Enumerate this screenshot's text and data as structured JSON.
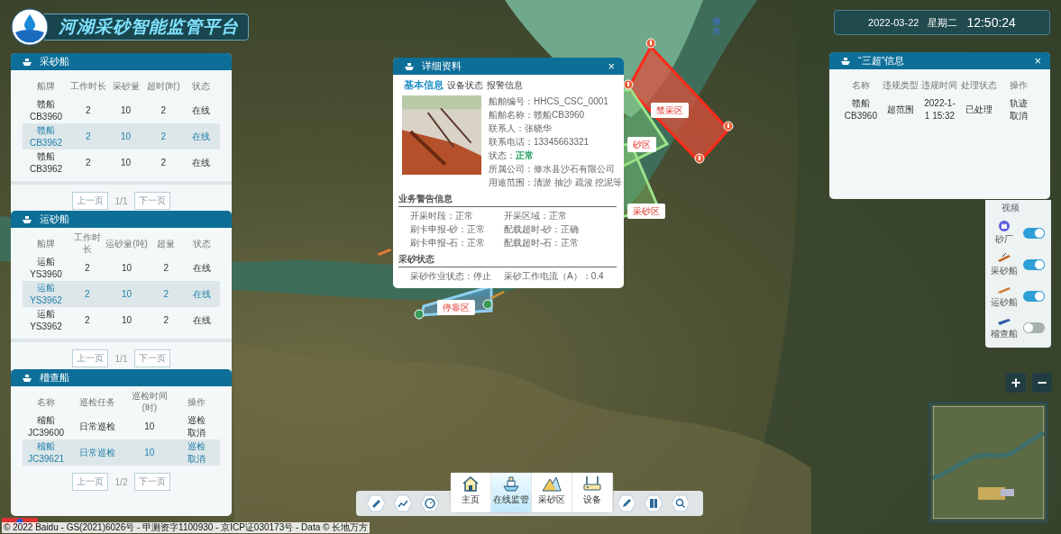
{
  "header": {
    "title": "河湖采砂智能监管平台"
  },
  "clock": {
    "date": "2022-03-22",
    "weekday": "星期二",
    "time": "12:50:24"
  },
  "mining_ships": {
    "title": "采砂船",
    "columns": [
      "船牌",
      "工作时长",
      "采砂量",
      "超时(时)",
      "状态"
    ],
    "rows": [
      {
        "cells": [
          "赣船 CB3960",
          "2",
          "10",
          "2",
          "在线"
        ],
        "selected": false
      },
      {
        "cells": [
          "赣船 CB3962",
          "2",
          "10",
          "2",
          "在线"
        ],
        "selected": true
      },
      {
        "cells": [
          "赣船 CB3962",
          "2",
          "10",
          "2",
          "在线"
        ],
        "selected": false
      }
    ],
    "pager": {
      "prev": "上一页",
      "page": "1/1",
      "next": "下一页"
    }
  },
  "transport_ships": {
    "title": "运砂船",
    "columns": [
      "船牌",
      "工作时长",
      "运砂量(吨)",
      "超量",
      "状态"
    ],
    "rows": [
      {
        "cells": [
          "运船 YS3960",
          "2",
          "10",
          "2",
          "在线"
        ],
        "selected": false
      },
      {
        "cells": [
          "运船 YS3962",
          "2",
          "10",
          "2",
          "在线"
        ],
        "selected": true
      },
      {
        "cells": [
          "运船 YS3962",
          "2",
          "10",
          "2",
          "在线"
        ],
        "selected": false
      }
    ],
    "pager": {
      "prev": "上一页",
      "page": "1/1",
      "next": "下一页"
    }
  },
  "patrol_ships": {
    "title": "稽查船",
    "columns": [
      "名称",
      "巡检任务",
      "巡检时间(时)",
      "操作"
    ],
    "rows": [
      {
        "cells": [
          "稽船 JC39600",
          "日常巡检",
          "10"
        ],
        "actions": [
          "巡检",
          "取消"
        ],
        "selected": false
      },
      {
        "cells": [
          "稽船 JC39621",
          "日常巡检",
          "10"
        ],
        "actions": [
          "巡检",
          "取消"
        ],
        "selected": true
      }
    ],
    "pager": {
      "prev": "上一页",
      "page": "1/2",
      "next": "下一页"
    }
  },
  "detail_popup": {
    "title": "详细资料",
    "close": "×",
    "tabs": [
      {
        "label": "基本信息",
        "selected": true
      },
      {
        "label": "设备状态",
        "selected": false
      },
      {
        "label": "报警信息",
        "selected": false
      }
    ],
    "fields": [
      {
        "label": "船舶编号：",
        "value": "HHCS_CSC_0001",
        "kind": "text"
      },
      {
        "label": "船舶名称：",
        "value": "赣船CB3960",
        "kind": "text"
      },
      {
        "label": "联系人：",
        "value": "张晓华",
        "kind": "text"
      },
      {
        "label": "联系电话：",
        "value": "13345663321",
        "kind": "text"
      },
      {
        "label": "状态：",
        "value": "正常",
        "kind": "status"
      },
      {
        "label": "所属公司：",
        "value": "修水县沙石有限公司",
        "kind": "text"
      },
      {
        "label": "用途范围：",
        "value": "清淤 抽沙 疏浚 挖泥等",
        "kind": "text"
      }
    ],
    "sections": [
      {
        "title": "业务警告信息",
        "items": [
          "开采时段：正常",
          "开采区域：正常",
          "刷卡申报-砂：正常",
          "配载超时-砂：正确",
          "刷卡申报-石：正常",
          "配载超时-石：正常"
        ]
      },
      {
        "title": "采砂状态",
        "items": [
          "采砂作业状态：停止",
          "采砂工作电流（A）：0.4"
        ]
      }
    ]
  },
  "violations": {
    "title": "“三超”信息",
    "close": "×",
    "columns": [
      "名称",
      "违规类型",
      "违规时间",
      "处理状态",
      "操作"
    ],
    "rows": [
      {
        "cells": [
          "赣船 CB3960",
          "超范围",
          "2022-1-1 15:32",
          "已处理"
        ],
        "actions": [
          "轨迹",
          "取消"
        ],
        "selected": false
      }
    ]
  },
  "layers": {
    "partial_label": "视频",
    "items": [
      {
        "label": "砂厂",
        "kind": "factory",
        "on": true
      },
      {
        "label": "采砂船",
        "kind": "mining",
        "on": true
      },
      {
        "label": "运砂船",
        "kind": "transport",
        "on": true
      },
      {
        "label": "稽查船",
        "kind": "patrol",
        "on": false
      }
    ]
  },
  "zoom": {
    "in": "+",
    "out": "−"
  },
  "map": {
    "river_label": "修水",
    "zones": [
      {
        "label": "禁采区",
        "kind": "forbidden"
      },
      {
        "label": "砂区",
        "kind": "mining"
      },
      {
        "label": "采砂区",
        "kind": "mining"
      },
      {
        "label": "停靠区",
        "kind": "parking"
      }
    ]
  },
  "toolbar": {
    "nav": [
      {
        "label": "主页",
        "selected": false
      },
      {
        "label": "在线监管",
        "selected": true
      },
      {
        "label": "采砂区",
        "selected": false
      },
      {
        "label": "设备",
        "selected": false
      }
    ]
  },
  "footer": {
    "copyright": "© 2022 Baidu - GS(2021)6026号 - 甲测资字1100930 - 京ICP证030173号 - Data © 长地万方"
  }
}
